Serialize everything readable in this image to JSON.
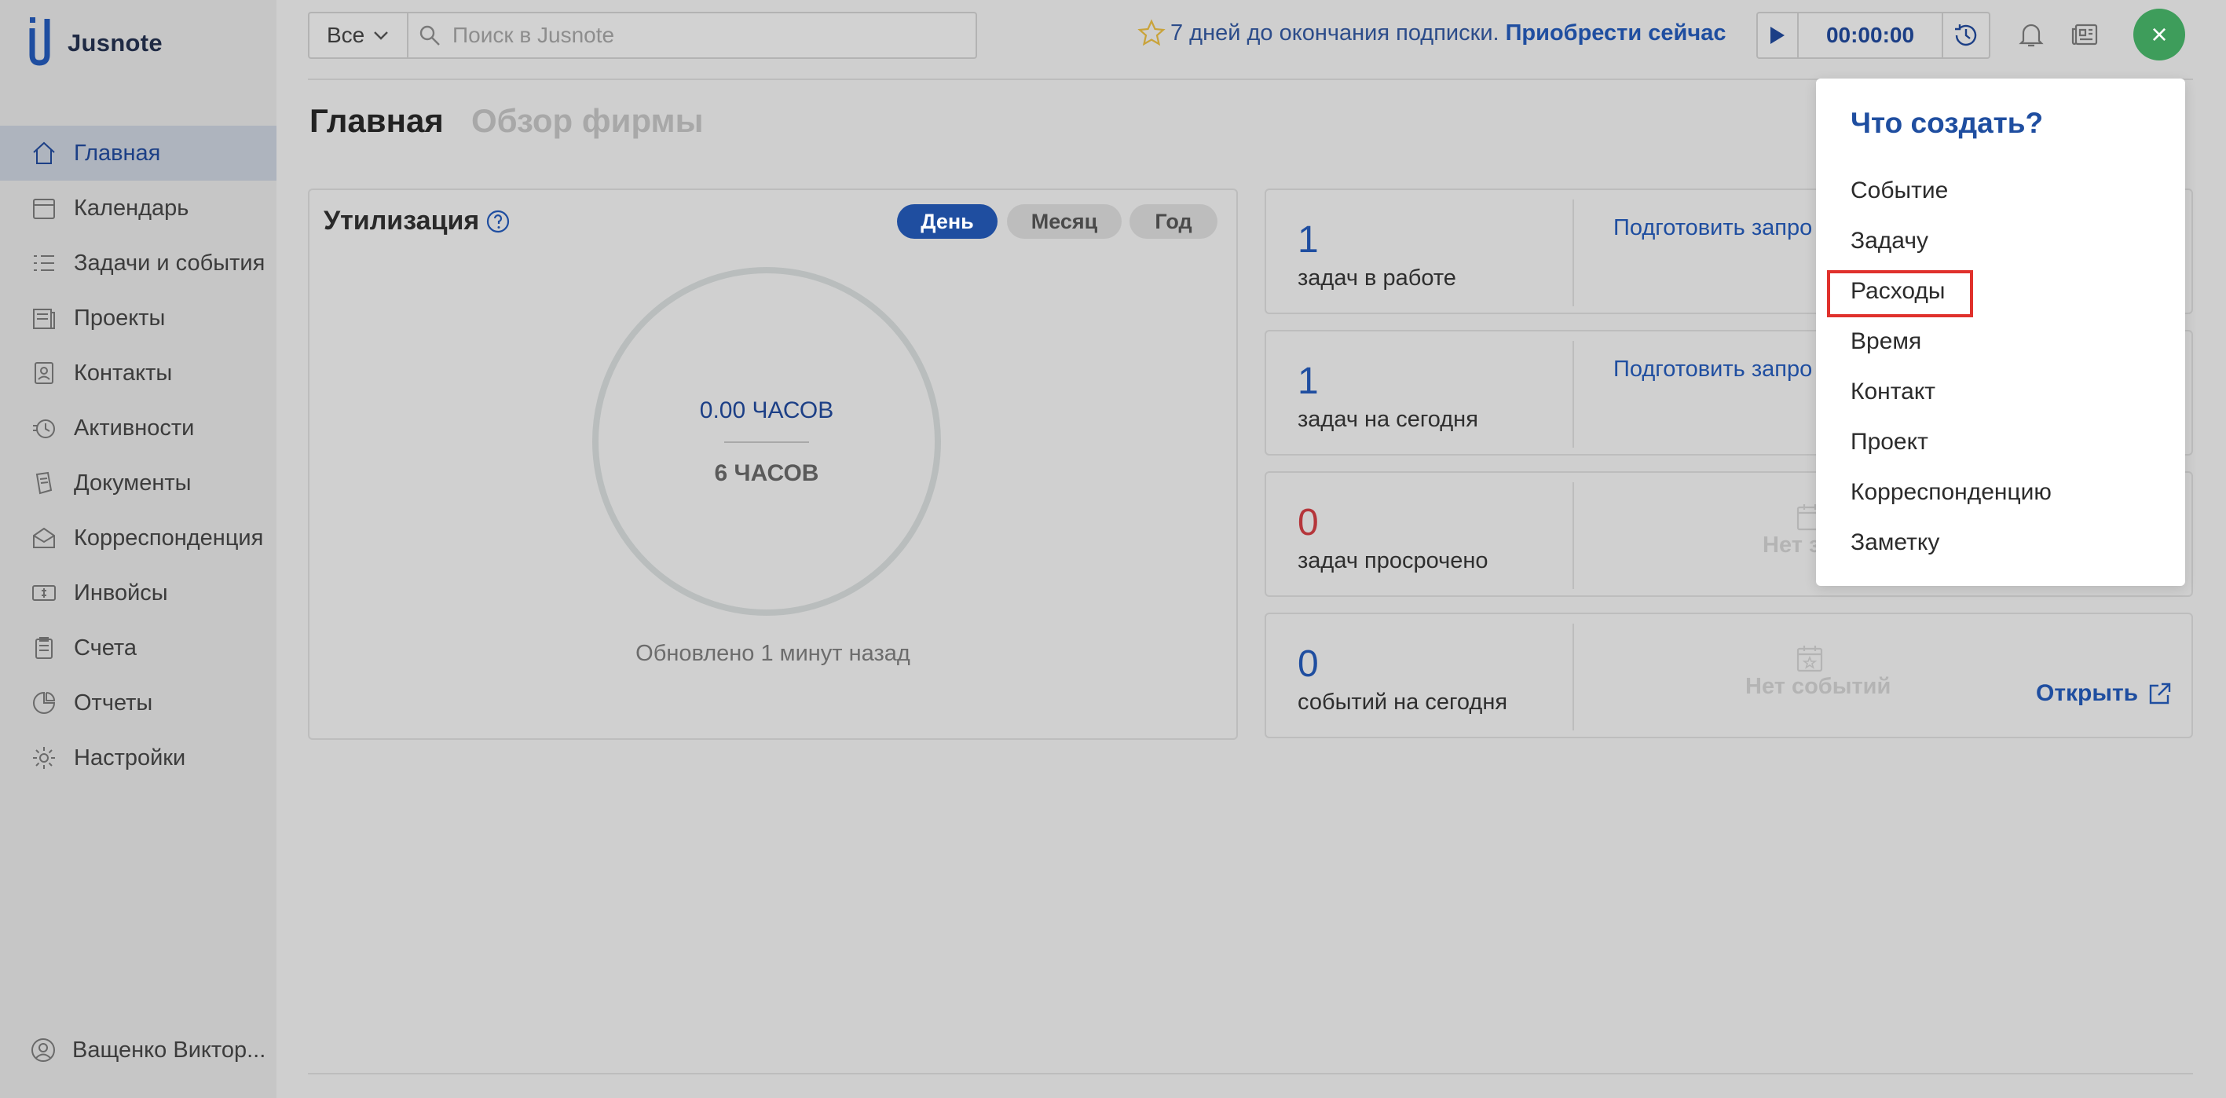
{
  "app": {
    "name": "Jusnote"
  },
  "sidebar": {
    "items": [
      {
        "label": "Главная",
        "icon": "home-icon"
      },
      {
        "label": "Календарь",
        "icon": "calendar-icon"
      },
      {
        "label": "Задачи и события",
        "icon": "tasks-icon"
      },
      {
        "label": "Проекты",
        "icon": "projects-icon"
      },
      {
        "label": "Контакты",
        "icon": "contacts-icon"
      },
      {
        "label": "Активности",
        "icon": "activity-icon"
      },
      {
        "label": "Документы",
        "icon": "documents-icon"
      },
      {
        "label": "Корреспонденция",
        "icon": "mail-icon"
      },
      {
        "label": "Инвойсы",
        "icon": "invoice-icon"
      },
      {
        "label": "Счета",
        "icon": "accounts-icon"
      },
      {
        "label": "Отчеты",
        "icon": "reports-icon"
      },
      {
        "label": "Настройки",
        "icon": "settings-icon"
      }
    ],
    "user": "Ващенко Виктор..."
  },
  "topbar": {
    "scope": "Все",
    "search_placeholder": "Поиск в Jusnote",
    "promo_text": "7 дней до окончания подписки.",
    "promo_link": "Приобрести сейчас",
    "timer": "00:00:00",
    "close": "×"
  },
  "tabs": {
    "home": "Главная",
    "overview": "Обзор фирмы"
  },
  "utilization": {
    "title": "Утилизация",
    "periods": [
      "День",
      "Месяц",
      "Год"
    ],
    "logged": "0.00 ЧАСОВ",
    "target": "6 ЧАСОВ",
    "updated": "Обновлено 1 минут назад"
  },
  "stats": [
    {
      "value": "1",
      "label": "задач в работе",
      "action": "Подготовить запро"
    },
    {
      "value": "1",
      "label": "задач на сегодня",
      "action": "Подготовить запро"
    },
    {
      "value": "0",
      "label": "задач просрочено",
      "empty": "Нет з"
    },
    {
      "value": "0",
      "label": "событий на сегодня",
      "empty": "Нет событий",
      "open": "Открыть"
    }
  ],
  "create_menu": {
    "title": "Что создать?",
    "items": [
      "Событие",
      "Задачу",
      "Расходы",
      "Время",
      "Контакт",
      "Проект",
      "Корреспонденцию",
      "Заметку"
    ]
  },
  "colors": {
    "accent": "#1f4ea0",
    "overdue": "#b5363b",
    "fab": "#3e9d5b",
    "highlight": "#e0312c"
  }
}
